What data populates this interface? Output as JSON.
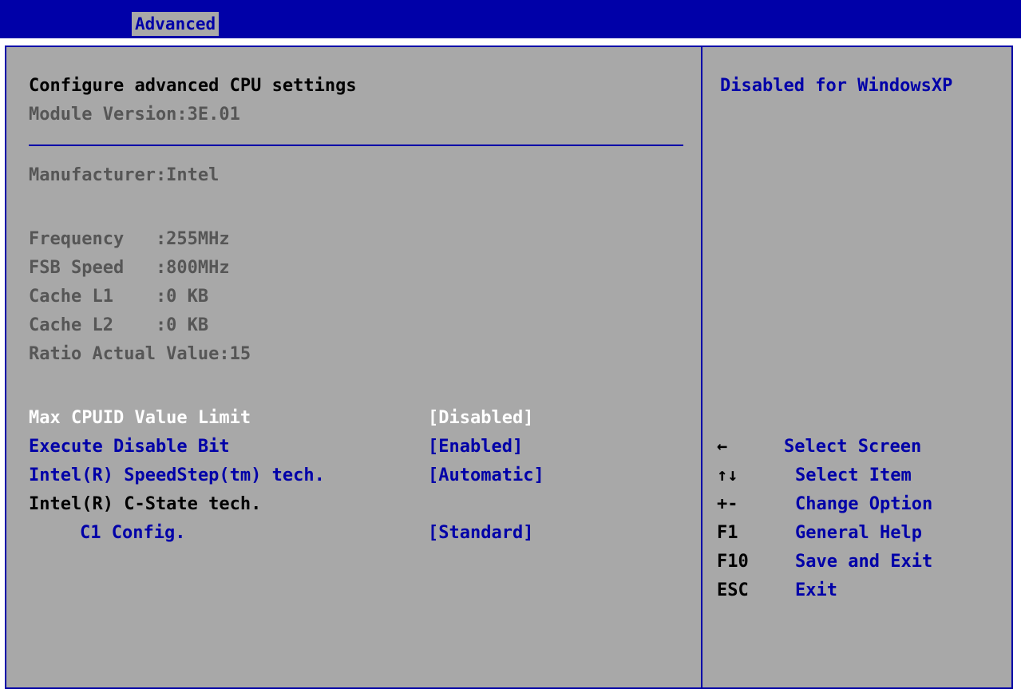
{
  "menu": {
    "active_tab": "Advanced"
  },
  "header": {
    "title": "Configure advanced CPU settings",
    "module_version": "Module Version:3E.01"
  },
  "cpu_info": {
    "manufacturer": "Manufacturer:Intel",
    "frequency": "Frequency   :255MHz",
    "fsb_speed": "FSB Speed   :800MHz",
    "cache_l1": "Cache L1    :0 KB",
    "cache_l2": "Cache L2    :0 KB",
    "ratio": "Ratio Actual Value:15"
  },
  "settings": [
    {
      "label": "Max CPUID Value Limit",
      "value": "[Disabled]"
    },
    {
      "label": "Execute Disable Bit",
      "value": "[Enabled]"
    },
    {
      "label": "Intel(R) SpeedStep(tm) tech.",
      "value": "[Automatic]"
    },
    {
      "label": "Intel(R) C-State tech.",
      "value": ""
    },
    {
      "label": "C1 Config.",
      "value": "[Standard]"
    }
  ],
  "help": {
    "text": "Disabled for WindowsXP"
  },
  "keys": [
    {
      "key": "←",
      "desc": "Select Screen"
    },
    {
      "key": "↑↓",
      "desc": "Select Item"
    },
    {
      "key": "+-",
      "desc": "Change Option"
    },
    {
      "key": "F1",
      "desc": "General Help"
    },
    {
      "key": "F10",
      "desc": "Save and Exit"
    },
    {
      "key": "ESC",
      "desc": "Exit"
    }
  ],
  "colors": {
    "bios_blue": "#0000a8",
    "bios_gray": "#a8a8a8",
    "highlight": "#ffffff"
  }
}
